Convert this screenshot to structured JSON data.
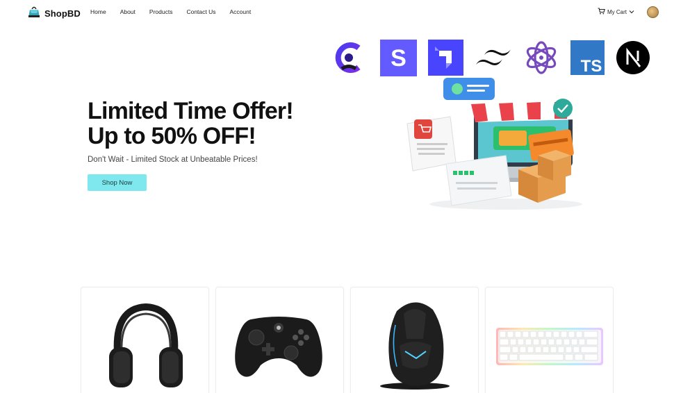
{
  "brand": {
    "name": "ShopBD"
  },
  "nav": {
    "links": [
      "Home",
      "About",
      "Products",
      "Contact Us",
      "Account"
    ],
    "cart_label": "My Cart"
  },
  "tech_logos": [
    "clerk-icon",
    "stripe-icon",
    "strapi-icon",
    "tailwind-icon",
    "redux-icon",
    "typescript-icon",
    "nextjs-icon"
  ],
  "typescript_badge_text": "TS",
  "stripe_badge_text": "S",
  "hero": {
    "title_line1": "Limited Time Offer!",
    "title_line2": "Up to 50% OFF!",
    "subtitle": "Don't Wait - Limited Stock at Unbeatable Prices!",
    "cta": "Shop Now"
  },
  "products": [
    {
      "image": "headphones-icon"
    },
    {
      "image": "game-controller-icon"
    },
    {
      "image": "gaming-mouse-icon"
    },
    {
      "image": "rgb-keyboard-icon"
    }
  ],
  "colors": {
    "cta_bg": "#7fe8ef",
    "accent_purple": "#5b4bdb",
    "ts_blue": "#3178c6"
  }
}
